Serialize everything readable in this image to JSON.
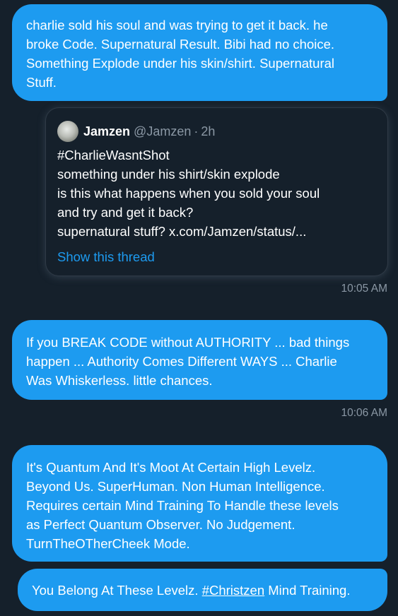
{
  "messages": [
    {
      "lines": [
        "charlie sold his soul and was trying to get it back. he",
        "broke Code. Supernatural Result. Bibi had no choice.",
        "Something Explode under his skin/shirt. Supernatural",
        "Stuff."
      ]
    }
  ],
  "quote": {
    "name": "Jamzen",
    "handle": "@Jamzen",
    "dot": "·",
    "time": "2h",
    "lines": [
      "#CharlieWasntShot",
      "something under his shirt/skin explode",
      "is this what happens when you sold your soul",
      "and try and get it back?",
      "supernatural stuff? x.com/Jamzen/status/..."
    ],
    "show_thread": "Show this thread",
    "avatar_icon": "avatar-icon"
  },
  "timestamps": [
    "10:05 AM",
    "10:06 AM"
  ],
  "message2": {
    "lines": [
      "If you BREAK CODE without AUTHORITY ... bad things",
      "happen ... Authority Comes Different WAYS ... Charlie",
      "Was Whiskerless. little chances."
    ]
  },
  "message3": {
    "lines": [
      "It's Quantum And It's Moot At Certain High Levelz.",
      "Beyond Us. SuperHuman. Non Human Intelligence.",
      "Requires certain Mind Training To Handle these levels",
      "as Perfect Quantum Observer. No Judgement.",
      "TurnTheOTherCheek Mode."
    ]
  },
  "message4": {
    "before": "You Belong At These Levelz. ",
    "hashtag": "#Christzen",
    "after": " Mind Training."
  },
  "colors": {
    "background": "#15202b",
    "bubble": "#1d9bf0",
    "muted": "#8b98a5",
    "link": "#1d9bf0"
  }
}
